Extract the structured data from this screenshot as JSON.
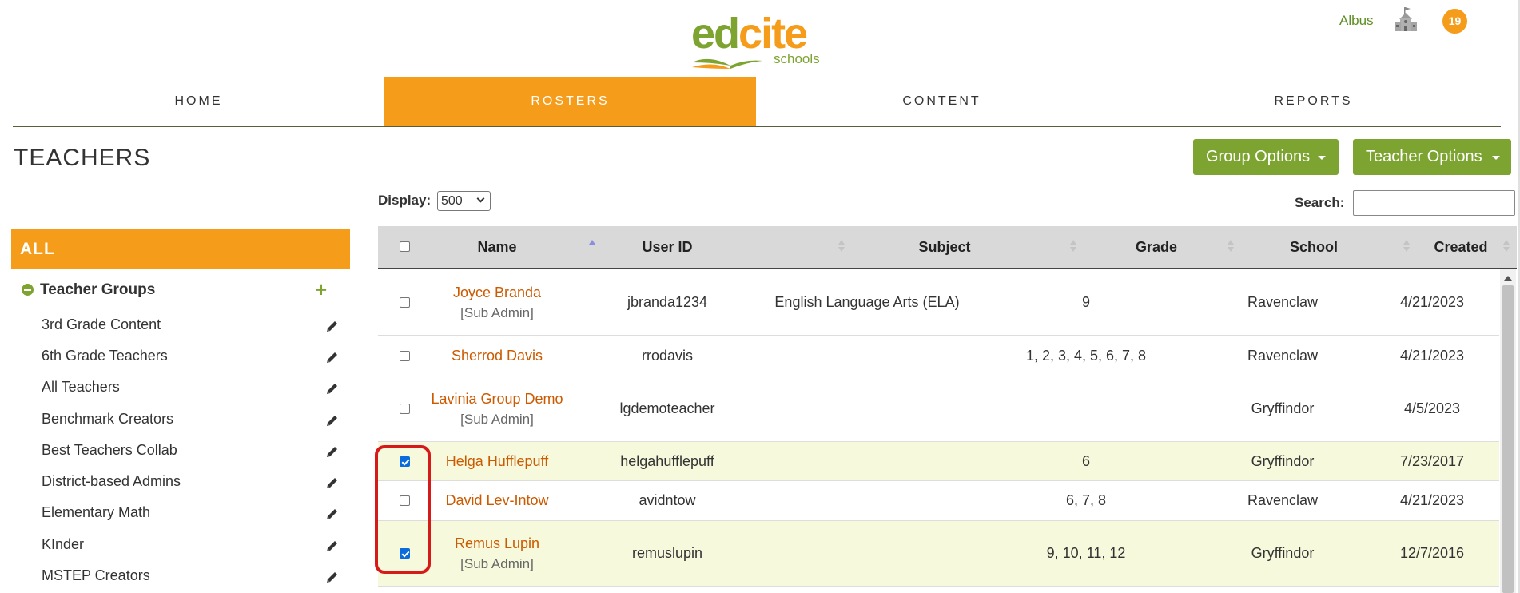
{
  "header": {
    "logo": {
      "ed": "ed",
      "cite": "cite",
      "sub": "schools"
    },
    "user_name": "Albus",
    "notification_count": "19",
    "icons": {
      "school": "school-building-icon"
    }
  },
  "nav": {
    "tabs": [
      {
        "label": "HOME",
        "active": false
      },
      {
        "label": "ROSTERS",
        "active": true
      },
      {
        "label": "CONTENT",
        "active": false
      },
      {
        "label": "REPORTS",
        "active": false
      }
    ]
  },
  "page": {
    "title": "TEACHERS",
    "group_options": "Group Options",
    "teacher_options": "Teacher Options"
  },
  "sidebar": {
    "all_label": "ALL",
    "groups_label": "Teacher Groups",
    "add_icon": "+",
    "groups": [
      "3rd Grade Content",
      "6th Grade Teachers",
      "All Teachers",
      "Benchmark Creators",
      "Best Teachers Collab",
      "District-based Admins",
      "Elementary Math",
      "KInder",
      "MSTEP Creators"
    ]
  },
  "table_controls": {
    "display_label": "Display:",
    "display_value": "500",
    "search_label": "Search:",
    "search_value": ""
  },
  "table": {
    "columns": [
      "Name",
      "User ID",
      "Subject",
      "Grade",
      "School",
      "Created"
    ],
    "sorted_column": "Name",
    "rows": [
      {
        "name": "Joyce Branda",
        "role": "[Sub Admin]",
        "user_id": "jbranda1234",
        "subject": "English Language Arts (ELA)",
        "grade": "9",
        "school": "Ravenclaw",
        "created": "4/21/2023",
        "checked": false
      },
      {
        "name": "Sherrod Davis",
        "role": "",
        "user_id": "rrodavis",
        "subject": "",
        "grade": "1, 2, 3, 4, 5, 6, 7, 8",
        "school": "Ravenclaw",
        "created": "4/21/2023",
        "checked": false
      },
      {
        "name": "Lavinia Group Demo",
        "role": "[Sub Admin]",
        "user_id": "lgdemoteacher",
        "subject": "",
        "grade": "",
        "school": "Gryffindor",
        "created": "4/5/2023",
        "checked": false
      },
      {
        "name": "Helga Hufflepuff",
        "role": "",
        "user_id": "helgahufflepuff",
        "subject": "",
        "grade": "6",
        "school": "Gryffindor",
        "created": "7/23/2017",
        "checked": true
      },
      {
        "name": "David Lev-Intow",
        "role": "",
        "user_id": "avidntow",
        "subject": "",
        "grade": "6, 7, 8",
        "school": "Ravenclaw",
        "created": "4/21/2023",
        "checked": false
      },
      {
        "name": "Remus Lupin",
        "role": "[Sub Admin]",
        "user_id": "remuslupin",
        "subject": "",
        "grade": "9, 10, 11, 12",
        "school": "Gryffindor",
        "created": "12/7/2016",
        "checked": true
      }
    ]
  },
  "colors": {
    "accent_orange": "#f59c1a",
    "accent_green": "#7da331",
    "link_orange": "#cc5a00",
    "selected_row": "#f6f9dc",
    "highlight_red": "#d61a1a"
  }
}
